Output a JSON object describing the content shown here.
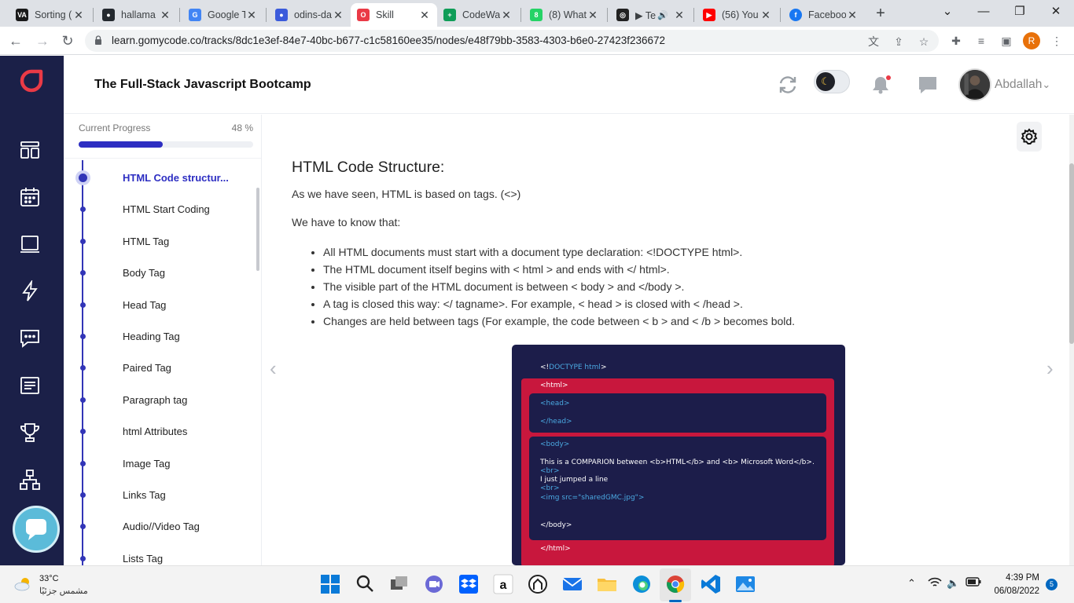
{
  "browser": {
    "tabs": [
      {
        "title": "Sorting (",
        "fav_color": "#1a1a1a",
        "fav_text": "VA"
      },
      {
        "title": "hallama",
        "fav_color": "#24292f",
        "fav_text": "●"
      },
      {
        "title": "Google T",
        "fav_color": "#4285f4",
        "fav_text": "G"
      },
      {
        "title": "odins-da",
        "fav_color": "#3b5bdb",
        "fav_text": "●"
      },
      {
        "title": "Skill",
        "fav_color": "#ea3a46",
        "fav_text": "O"
      },
      {
        "title": "CodeWa",
        "fav_color": "#0f9d58",
        "fav_text": "+"
      },
      {
        "title": "(8) What",
        "fav_color": "#25d366",
        "fav_text": "8"
      },
      {
        "title": "▶ Te",
        "fav_color": "#222222",
        "fav_text": "◎"
      },
      {
        "title": "(56) You",
        "fav_color": "#ff0000",
        "fav_text": "▶"
      },
      {
        "title": "Faceboo",
        "fav_color": "#1877f2",
        "fav_text": "f"
      }
    ],
    "active_tab": 4,
    "url": "learn.gomycode.co/tracks/8dc1e3ef-84e7-40bc-b677-c1c58160ee35/nodes/e48f79bb-3583-4303-b6e0-27423f236672",
    "profile_initial": "R"
  },
  "header": {
    "course_title": "The Full-Stack Javascript Bootcamp",
    "username": "Abdallah",
    "dropdown_glyph": "⌄"
  },
  "progress": {
    "label": "Current Progress",
    "percent_text": "48 %",
    "value": 0.48
  },
  "lessons": [
    "HTML Code structur...",
    "HTML Start Coding",
    "HTML Tag",
    "Body Tag",
    "Head Tag",
    "Heading Tag",
    "Paired Tag",
    "Paragraph tag",
    "html Attributes",
    "Image Tag",
    "Links Tag",
    "Audio//Video Tag",
    "Lists Tag"
  ],
  "content": {
    "title": "HTML Code Structure:",
    "intro": "As we have seen, HTML is based on tags. (<>)",
    "know": "We have to know that:",
    "bullets": [
      "All HTML documents must start with a document type declaration: <!DOCTYPE html>.",
      "The HTML document itself begins with < html > and ends with </ html>.",
      "The visible part of the HTML document is between < body > and </body >.",
      "A tag is closed this way: </ tagname>. For example, < head > is closed with < /head >.",
      "Changes are held between tags (For example, the code between < b > and < /b > becomes bold."
    ]
  },
  "code_image": {
    "doctype_open": "<!",
    "doctype_kw": "DOCTYPE html",
    "doctype_close": ">",
    "html_open": "<html>",
    "head_open": "<head>",
    "head_close": "</head>",
    "body_open": "<body>",
    "line1": "This is a COMPARION between <b>HTML</b> and <b> Microsoft Word</b>.",
    "br1": "<br>",
    "line2": "I just jumped a line",
    "br2": "<br>",
    "img": "<img src=\"sharedGMC.jpg\">",
    "body_close": "</body>",
    "html_close": "</html>"
  },
  "taskbar": {
    "temperature": "33°C",
    "weather_desc": "مشمس جزئيًا",
    "time": "4:39 PM",
    "date": "06/08/2022",
    "notifications": "5"
  },
  "colors": {
    "rail": "#1b2048",
    "accent": "#2d2ec2",
    "brand_red": "#ea3a46",
    "code_bg": "#1c1d4a",
    "code_red": "#c8173d"
  }
}
